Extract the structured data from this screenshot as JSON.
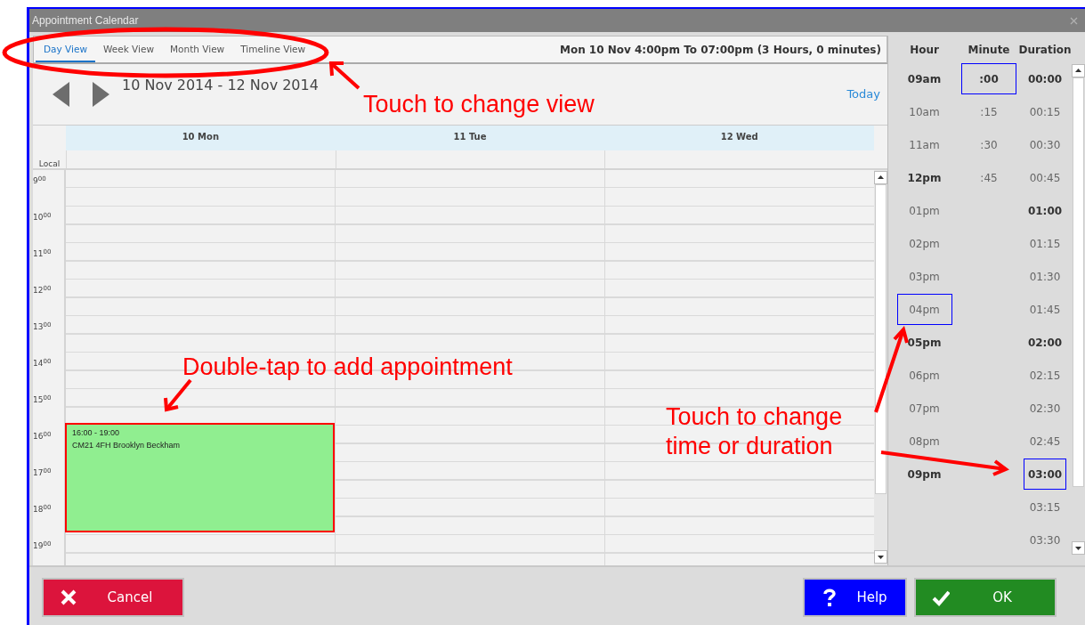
{
  "window": {
    "title": "Appointment Calendar"
  },
  "tabs": [
    {
      "label": "Day View",
      "selected": true
    },
    {
      "label": "Week View",
      "selected": false
    },
    {
      "label": "Month View",
      "selected": false
    },
    {
      "label": "Timeline View",
      "selected": false
    }
  ],
  "range_summary": "Mon 10 Nov 4:00pm To 07:00pm (3 Hours, 0 minutes)",
  "date_range": "10 Nov 2014  - 12 Nov 2014",
  "today_link": "Today",
  "calendar": {
    "days": [
      {
        "label": "10 Mon",
        "appointments": [
          {
            "time": "16:00  -  19:00",
            "details": "CM21  4FH  Brooklyn Beckham"
          }
        ]
      },
      {
        "label": "11 Tue"
      },
      {
        "label": "12 Wed"
      }
    ],
    "timezone_label": "Local",
    "hours": [
      "9$^{00}$",
      "10$^{00}$",
      "11$^{00}$",
      "12$^{00}$",
      "13$^{00}$",
      "14$^{00}$",
      "15$^{00}$",
      "16$^{00}$",
      "17$^{00}$",
      "18$^{00}$",
      "19$^{00}$"
    ]
  },
  "picker": {
    "columns": [
      {
        "header": "Hour",
        "items": [
          {
            "label": "09am",
            "bold": true,
            "selected": false
          },
          {
            "label": "10am",
            "bold": false,
            "selected": false
          },
          {
            "label": "11am",
            "bold": false,
            "selected": false
          },
          {
            "label": "12pm",
            "bold": true,
            "selected": false
          },
          {
            "label": "01pm",
            "bold": false,
            "selected": false
          },
          {
            "label": "02pm",
            "bold": false,
            "selected": false
          },
          {
            "label": "03pm",
            "bold": false,
            "selected": false
          },
          {
            "label": "04pm",
            "bold": false,
            "selected": true
          },
          {
            "label": "05pm",
            "bold": true,
            "selected": false
          },
          {
            "label": "06pm",
            "bold": false,
            "selected": false
          },
          {
            "label": "07pm",
            "bold": false,
            "selected": false
          },
          {
            "label": "08pm",
            "bold": false,
            "selected": false
          },
          {
            "label": "09pm",
            "bold": true,
            "selected": false
          }
        ]
      },
      {
        "header": "Minute",
        "items": [
          {
            "label": ":00",
            "bold": true,
            "selected": true
          },
          {
            "label": ":15",
            "bold": false,
            "selected": false
          },
          {
            "label": ":30",
            "bold": false,
            "selected": false
          },
          {
            "label": ":45",
            "bold": false,
            "selected": false
          }
        ]
      },
      {
        "header": "Duration",
        "items": [
          {
            "label": "00:00",
            "bold": true,
            "selected": false
          },
          {
            "label": "00:15",
            "bold": false,
            "selected": false
          },
          {
            "label": "00:30",
            "bold": false,
            "selected": false
          },
          {
            "label": "00:45",
            "bold": false,
            "selected": false
          },
          {
            "label": "01:00",
            "bold": true,
            "selected": false
          },
          {
            "label": "01:15",
            "bold": false,
            "selected": false
          },
          {
            "label": "01:30",
            "bold": false,
            "selected": false
          },
          {
            "label": "01:45",
            "bold": false,
            "selected": false
          },
          {
            "label": "02:00",
            "bold": true,
            "selected": false
          },
          {
            "label": "02:15",
            "bold": false,
            "selected": false
          },
          {
            "label": "02:30",
            "bold": false,
            "selected": false
          },
          {
            "label": "02:45",
            "bold": false,
            "selected": false
          },
          {
            "label": "03:00",
            "bold": true,
            "selected": true
          },
          {
            "label": "03:15",
            "bold": false,
            "selected": false
          },
          {
            "label": "03:30",
            "bold": false,
            "selected": false
          }
        ]
      }
    ]
  },
  "buttons": [
    {
      "kind": "cancel",
      "label": "Cancel"
    },
    {
      "kind": "help",
      "label": "Help"
    },
    {
      "kind": "ok",
      "label": "OK"
    }
  ],
  "annotations": [
    {
      "text": "Touch to change view"
    },
    {
      "text": "Double-tap to add appointment"
    },
    {
      "text": "Touch to change time or duration"
    }
  ]
}
